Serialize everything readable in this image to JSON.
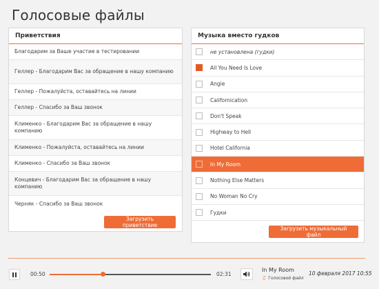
{
  "page": {
    "title": "Голосовые файлы"
  },
  "greetings": {
    "header": "Приветствия",
    "items": [
      "Благодарим за Ваше участие в тестировании",
      "Геллер - Благодарим Вас за обращение в нашу компанию",
      "Геллер - Пожалуйста, оставайтесь на линии",
      "Геллер - Спасибо за Ваш звонок",
      "Клименко - Благодарим Вас за обращение в нашу компанию",
      "Клименко - Пожалуйста, оставайтесь на линии",
      "Клименко - Спасибо за Ваш звонок",
      "Концевич - Благодарим Вас за обращение в нашу компанию",
      "Черняк - Спасибо за Ваш звонок"
    ],
    "upload_label": "Загрузить приветствие"
  },
  "music": {
    "header": "Музыка вместо гудков",
    "items": [
      {
        "label": "не установлена (гудки)",
        "checked": false
      },
      {
        "label": "All You Need Is Love",
        "checked": true
      },
      {
        "label": "Angie",
        "checked": false
      },
      {
        "label": "Californication",
        "checked": false
      },
      {
        "label": "Don't Speak",
        "checked": false
      },
      {
        "label": "Highway to Hell",
        "checked": false
      },
      {
        "label": "Hotel California",
        "checked": false
      },
      {
        "label": "In My Room",
        "checked": false,
        "selected": true
      },
      {
        "label": "Nothing Else Matters",
        "checked": false
      },
      {
        "label": "No Woman No Cry",
        "checked": false
      },
      {
        "label": "Гудки",
        "checked": false
      }
    ],
    "upload_label": "Загрузить музыкальный файл"
  },
  "player": {
    "current_time": "00:50",
    "total_time": "02:31",
    "progress": 0.33,
    "track_title": "In My Room",
    "track_type": "Голосовой файл",
    "date": "10 февраля 2017 10:55",
    "icons": {
      "play_pause": "pause-icon",
      "volume": "speaker-icon",
      "type": "music-note-icon"
    },
    "accent_color": "#ef6c37"
  }
}
